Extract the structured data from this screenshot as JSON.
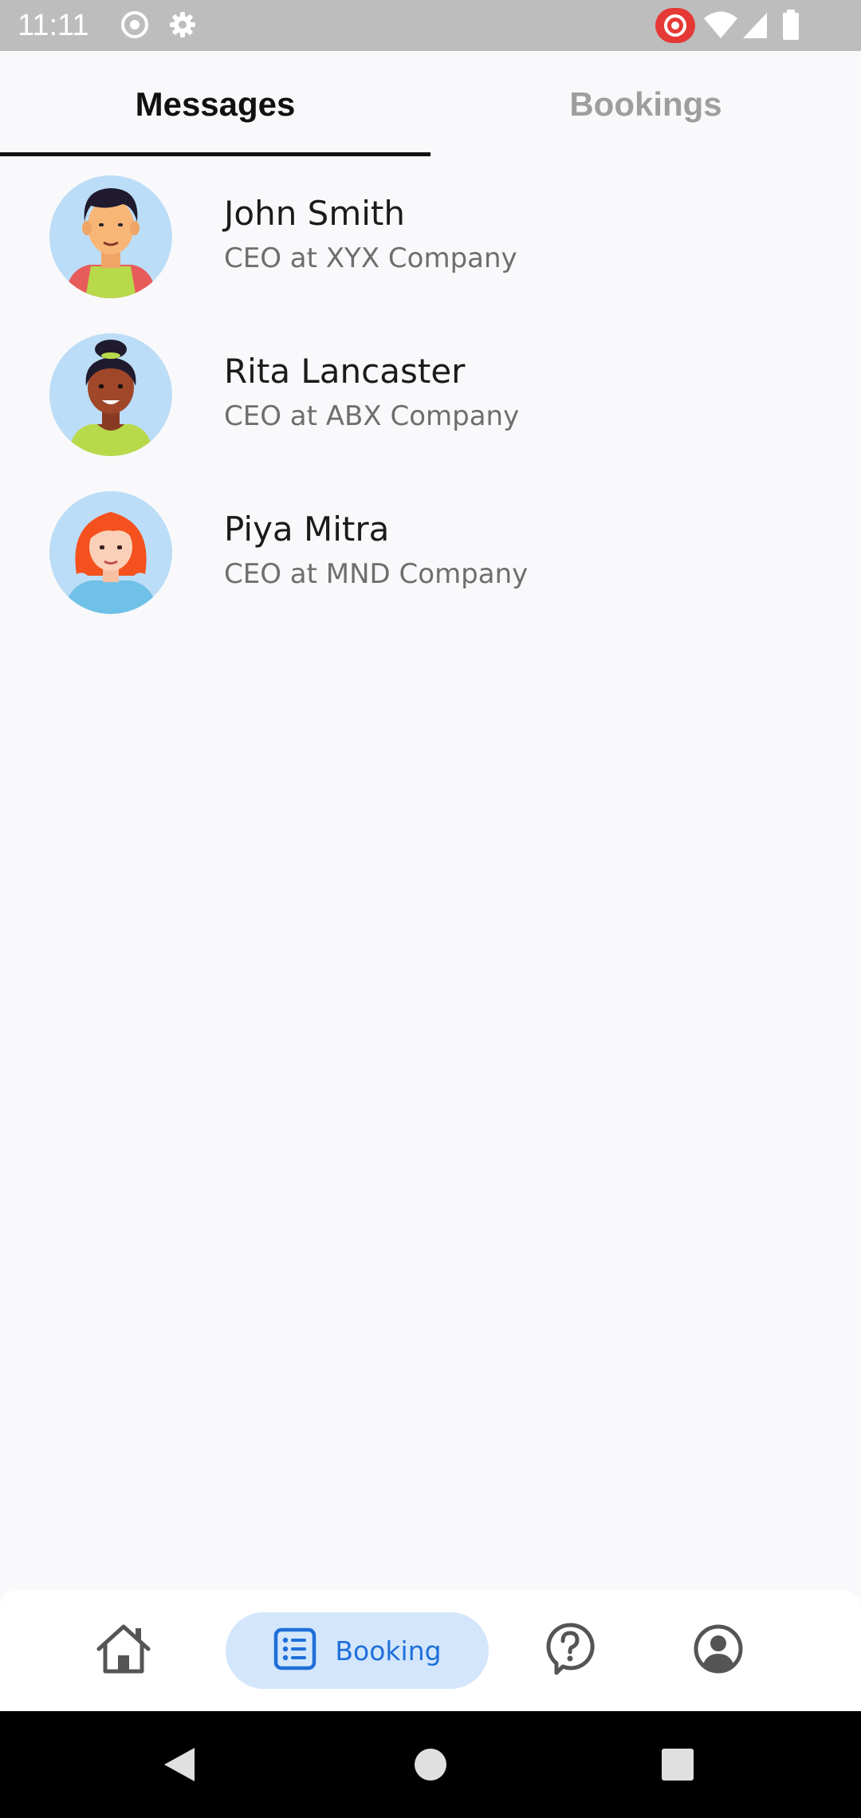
{
  "status_bar": {
    "time": "11:11",
    "icons": [
      "screen-record-icon",
      "settings-gear-icon",
      "recording-active-icon",
      "wifi-icon",
      "signal-icon",
      "battery-icon"
    ]
  },
  "tabs": [
    {
      "label": "Messages",
      "active": true
    },
    {
      "label": "Bookings",
      "active": false
    }
  ],
  "contacts": [
    {
      "name": "John Smith",
      "role": "CEO at XYX Company"
    },
    {
      "name": "Rita Lancaster",
      "role": "CEO at ABX Company"
    },
    {
      "name": "Piya Mitra",
      "role": "CEO at MND Company"
    }
  ],
  "bottom_nav": {
    "items": [
      {
        "icon": "home-icon",
        "label": ""
      },
      {
        "icon": "list-icon",
        "label": "Booking",
        "active": true
      },
      {
        "icon": "help-icon",
        "label": ""
      },
      {
        "icon": "profile-icon",
        "label": ""
      }
    ]
  },
  "system_nav": [
    "back-icon",
    "home-circle-icon",
    "recents-icon"
  ],
  "colors": {
    "status_bar": "#BDBDBD",
    "background": "#F9F9FB",
    "accent": "#1E6FD9",
    "accent_pill": "#D3E6FB",
    "record_red": "#E53935"
  }
}
